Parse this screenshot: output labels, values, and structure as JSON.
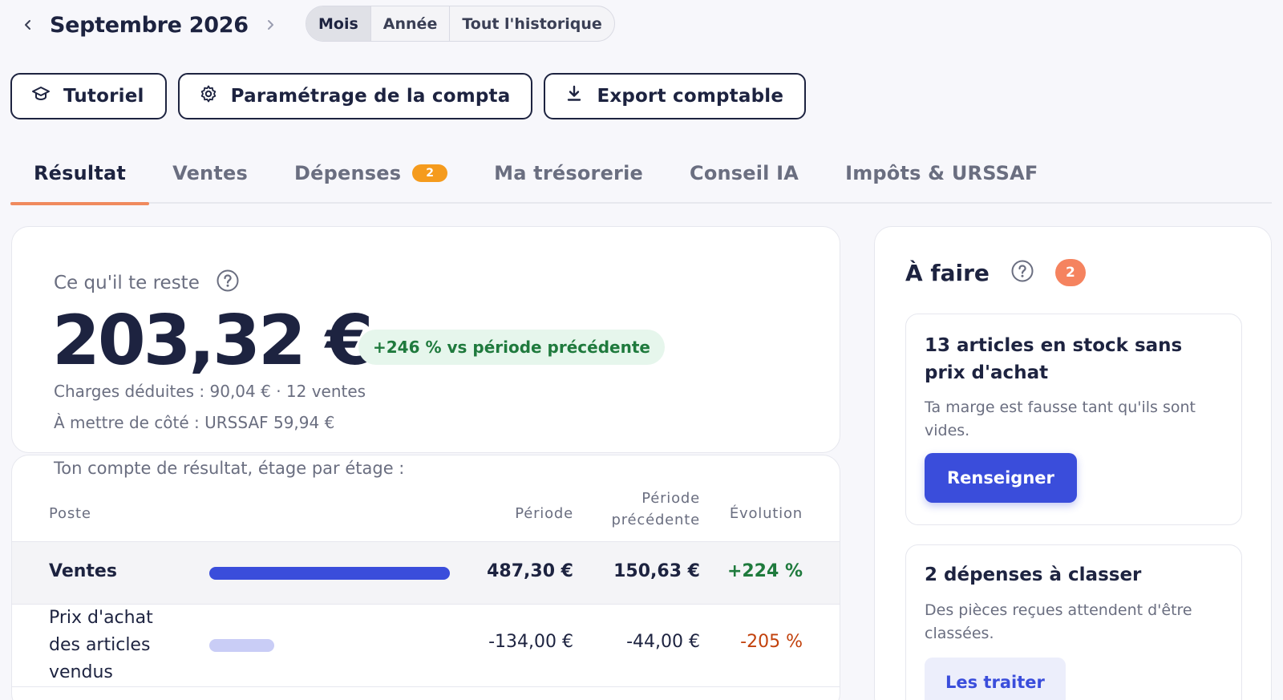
{
  "period": {
    "title": "Septembre 2026",
    "segments": [
      {
        "label": "Mois",
        "active": true
      },
      {
        "label": "Année",
        "active": false
      },
      {
        "label": "Tout l'historique",
        "active": false
      }
    ]
  },
  "actions": {
    "tutoriel": "Tutoriel",
    "parametrage": "Paramétrage de la compta",
    "export": "Export comptable"
  },
  "tabs": [
    {
      "label": "Résultat",
      "active": true
    },
    {
      "label": "Ventes"
    },
    {
      "label": "Dépenses",
      "badge": "2"
    },
    {
      "label": "Ma trésorerie"
    },
    {
      "label": "Conseil IA"
    },
    {
      "label": "Impôts & URSSAF"
    }
  ],
  "result": {
    "label": "Ce qu'il te reste",
    "amount": "203,32 €",
    "evolution": "+246 % vs période précédente",
    "charges": "Charges déduites : 90,04 € · 12 ventes",
    "aside": "À mettre de côté : URSSAF 59,94 €"
  },
  "table": {
    "intro": "Ton compte de résultat, étage par étage :",
    "headers": {
      "poste": "Poste",
      "periode": "Période",
      "precedente": "Période précédente",
      "evolution": "Évolution"
    },
    "rows": [
      {
        "poste": "Ventes",
        "bar": 1.0,
        "periode": "487,30 €",
        "precedente": "150,63 €",
        "evolution": "+224 %"
      },
      {
        "poste": "Prix d'achat des articles vendus",
        "bar": 0.27,
        "periode": "-134,00 €",
        "precedente": "-44,00 €",
        "evolution": "-205 %"
      }
    ]
  },
  "todo": {
    "title": "À faire",
    "count": "2",
    "items": [
      {
        "title": "13 articles en stock sans prix d'achat",
        "desc": "Ta marge est fausse tant qu'ils sont vides.",
        "action": "Renseigner"
      },
      {
        "title": "2 dépenses à classer",
        "desc": "Des pièces reçues attendent d'être classées.",
        "action": "Les traiter"
      }
    ]
  },
  "colors": {
    "accent": "#3a4ddb",
    "tab_underline": "#f08a5d",
    "positive": "#1f7a3d",
    "negative": "#c2410c",
    "badge_orange": "#f59b1d"
  },
  "icons": {
    "prev": "chevron-left-icon",
    "next": "chevron-right-icon",
    "tutoriel": "graduation-cap-icon",
    "parametrage": "gear-icon",
    "export": "download-icon",
    "help": "question-circle-icon"
  }
}
